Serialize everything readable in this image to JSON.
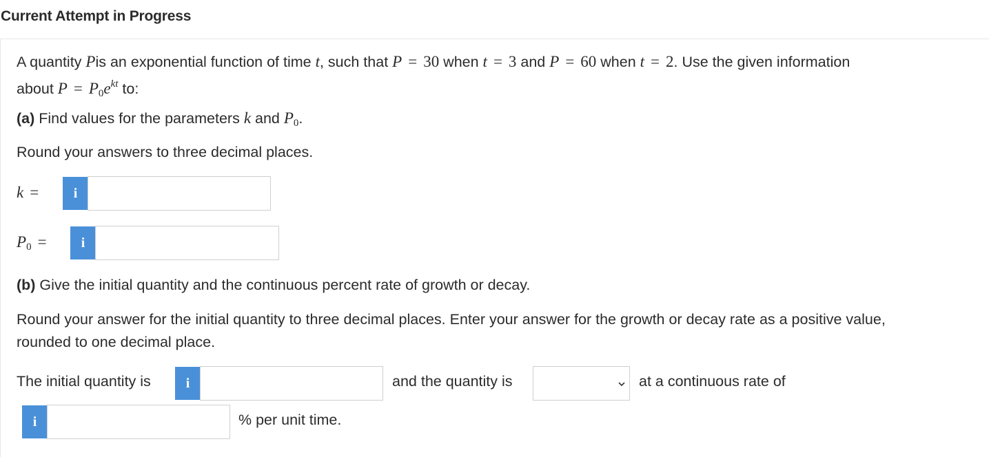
{
  "header": {
    "title": "Current Attempt in Progress"
  },
  "problem": {
    "intro_a": "A quantity ",
    "var_P": "P",
    "intro_b": "is an exponential function of time ",
    "var_t": "t",
    "intro_c": ", such that ",
    "eq1_lhs": "P",
    "eq_sign": "=",
    "eq1_rhs": "30",
    "when1": " when ",
    "eq2_lhs": "t",
    "eq2_rhs": "3",
    "and1": " and ",
    "eq3_lhs": "P",
    "eq3_rhs": "60",
    "when2": " when ",
    "eq4_lhs": "t",
    "eq4_rhs": "2",
    "outro": ". Use the given information",
    "line2_a": "about ",
    "formula_P": "P",
    "formula_P0_base": "P",
    "formula_P0_sub": "0",
    "formula_e": "e",
    "formula_exp": "kt",
    "line2_b": " to:"
  },
  "part_a": {
    "label": "(a)",
    "text_a": " Find values for the parameters ",
    "var_k": "k",
    "text_b": " and ",
    "var_P0_base": "P",
    "var_P0_sub": "0",
    "text_c": ".",
    "round_text": "Round your answers to three decimal places.",
    "k_label": "k",
    "k_eq": "=",
    "k_value": "",
    "p0_label_base": "P",
    "p0_label_sub": "0",
    "p0_eq": "=",
    "p0_value": ""
  },
  "part_b": {
    "label": "(b)",
    "text": " Give the initial quantity and the continuous percent rate of growth or decay.",
    "round_line1": "Round your answer for the initial quantity to three decimal places. Enter your answer for the growth or decay rate as a positive value,",
    "round_line2": "rounded to one decimal place.",
    "initial_label": "The initial quantity is",
    "initial_value": "",
    "quantity_label": "and the quantity is",
    "select_value": "",
    "rate_label": "at a continuous rate of",
    "rate_value": "",
    "unit_label": "% per unit time."
  },
  "info_icon_glyph": "i",
  "colors": {
    "info_button": "#4a90d9",
    "text": "#2b2b2b",
    "border": "#cfcfcf"
  }
}
